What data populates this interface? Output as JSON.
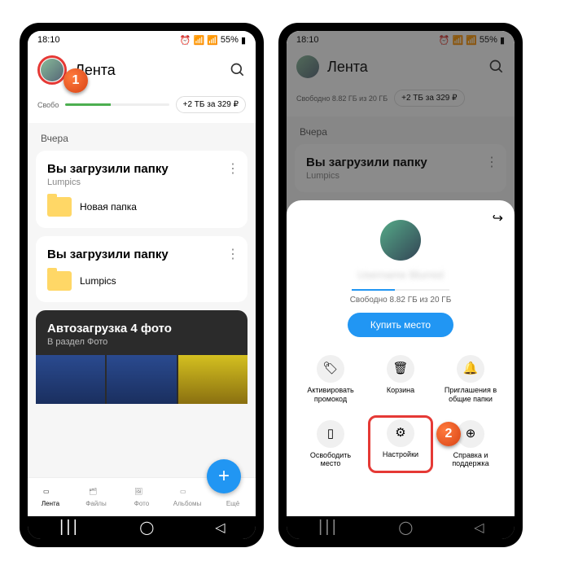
{
  "status": {
    "time": "18:10",
    "battery": "55%"
  },
  "header": {
    "title": "Лента"
  },
  "storage": {
    "text": "Свободно 8.82 ГБ из 20 ГБ",
    "promo": "+2 ТБ за 329 ₽"
  },
  "section": "Вчера",
  "card1": {
    "title": "Вы загрузили папку",
    "sub": "Lumpics",
    "folder": "Новая папка"
  },
  "card2": {
    "title": "Вы загрузили папку",
    "sub": "",
    "folder": "Lumpics"
  },
  "autoload": {
    "title": "Автозагрузка 4 фото",
    "sub": "В раздел Фото"
  },
  "tabs": [
    "Лента",
    "Файлы",
    "Фото",
    "Альбомы",
    "Ещё"
  ],
  "sheet": {
    "name": "Username Blurred",
    "storage": "Свободно 8.82 ГБ из 20 ГБ",
    "buy": "Купить место",
    "items": [
      {
        "label": "Активировать промокод",
        "icon": "🏷"
      },
      {
        "label": "Корзина",
        "icon": "🗑"
      },
      {
        "label": "Приглашения в общие папки",
        "icon": "🔔"
      },
      {
        "label": "Освободить место",
        "icon": "▯"
      },
      {
        "label": "Настройки",
        "icon": "⚙"
      },
      {
        "label": "Справка и поддержка",
        "icon": "⊕"
      }
    ]
  },
  "callouts": {
    "one": "1",
    "two": "2"
  }
}
